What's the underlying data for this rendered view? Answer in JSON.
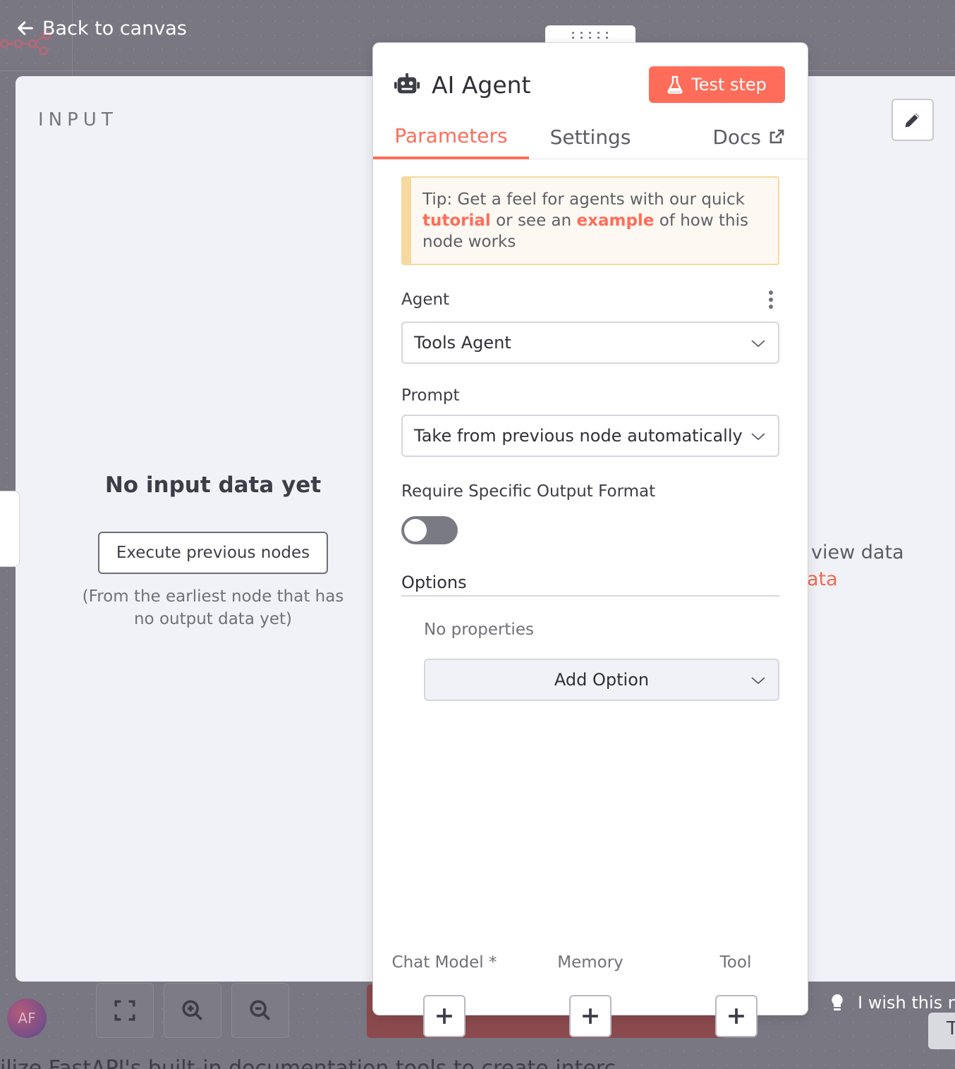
{
  "header": {
    "back_label": "Back to canvas"
  },
  "input_panel": {
    "heading": "INPUT",
    "empty_title": "No input data yet",
    "execute_button": "Execute previous nodes",
    "execute_hint": "(From the earliest node that has no output data yet)"
  },
  "output_panel": {
    "hint_line_1": "view data",
    "hint_line_2": "ata"
  },
  "node": {
    "title": "AI Agent",
    "test_button": "Test step",
    "tabs": [
      {
        "label": "Parameters",
        "active": true
      },
      {
        "label": "Settings",
        "active": false
      },
      {
        "label": "Docs",
        "active": false
      }
    ],
    "tip": {
      "prefix": "Tip: Get a feel for agents with our quick ",
      "link_1": "tutorial",
      "middle": " or see an ",
      "link_2": "example",
      "suffix": " of how this node works"
    },
    "fields": {
      "agent": {
        "label": "Agent",
        "value": "Tools Agent"
      },
      "prompt": {
        "label": "Prompt",
        "value": "Take from previous node automatically"
      },
      "output_format": {
        "label": "Require Specific Output Format",
        "enabled": false
      }
    },
    "options": {
      "label": "Options",
      "empty": "No properties",
      "add_button": "Add Option"
    },
    "connections": [
      {
        "label": "Chat Model *"
      },
      {
        "label": "Memory"
      },
      {
        "label": "Tool"
      }
    ]
  },
  "canvas_toolbar": {
    "avatar_initials": "AF",
    "feedback_text": "I wish this no",
    "feedback_button": "T"
  },
  "background_text": "ilize FastAPI's built-in documentation tools to create interc",
  "colors": {
    "accent": "#ff6d5a",
    "canvas": "#797782",
    "panel_bg": "#f1f2f7",
    "tip_border": "#f5d99e"
  },
  "icons": {
    "back": "arrow-left-icon",
    "node": "robot-icon",
    "test": "flask-icon",
    "docs": "external-link-icon",
    "edit": "pencil-icon",
    "fit": "fit-view-icon",
    "zoom_in": "zoom-in-icon",
    "zoom_out": "zoom-out-icon",
    "feedback": "lightbulb-icon",
    "add": "plus-icon"
  }
}
